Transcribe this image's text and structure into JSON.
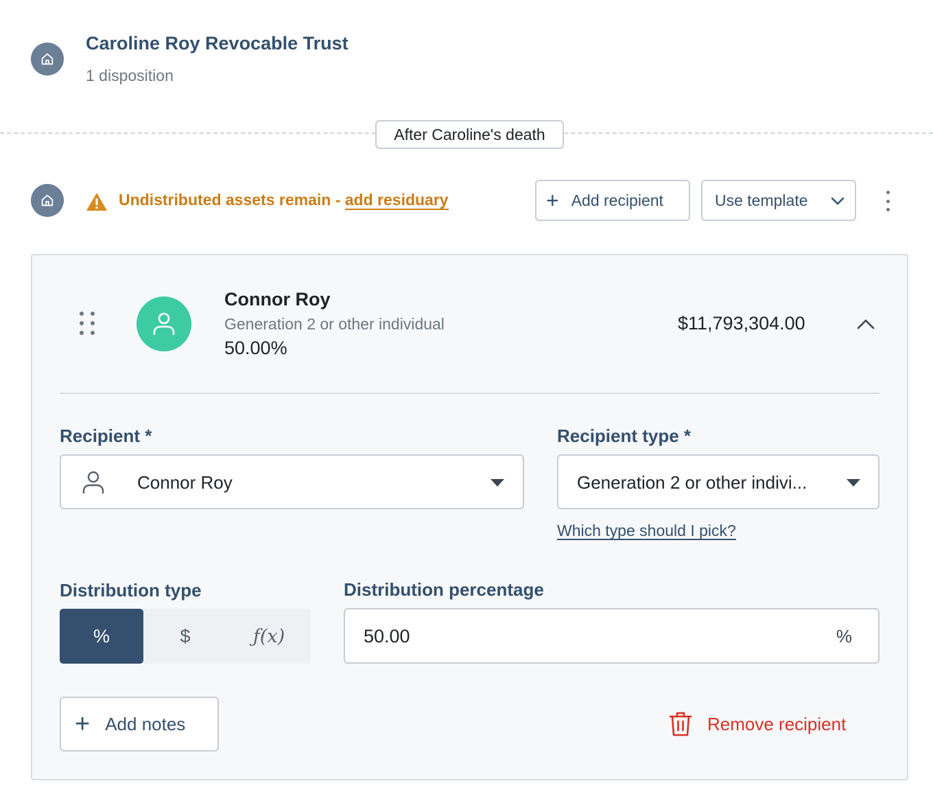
{
  "header": {
    "title": "Caroline Roy Revocable Trust",
    "subtitle": "1 disposition"
  },
  "timeline": {
    "label": "After Caroline's death"
  },
  "warning": {
    "text": "Undistributed assets remain - ",
    "link": "add residuary"
  },
  "toolbar": {
    "add_recipient": "Add recipient",
    "use_template": "Use template"
  },
  "recipient_card": {
    "name": "Connor Roy",
    "type": "Generation 2 or other individual",
    "percentage": "50.00%",
    "amount": "$11,793,304.00",
    "form": {
      "recipient_label": "Recipient *",
      "recipient_value": "Connor Roy",
      "recipient_type_label": "Recipient type *",
      "recipient_type_value": "Generation 2 or other indivi...",
      "help_link": "Which type should I pick?",
      "distribution_type_label": "Distribution type",
      "distribution_options": [
        "%",
        "$",
        "ƒ(x)"
      ],
      "distribution_selected": "%",
      "distribution_percentage_label": "Distribution percentage",
      "distribution_percentage_value": "50.00",
      "distribution_unit": "%",
      "add_notes": "Add notes",
      "remove_recipient": "Remove recipient"
    }
  },
  "colors": {
    "primary": "#34506e",
    "warning": "#c97d18",
    "avatar": "#3dcba4",
    "danger": "#d93025",
    "badge": "#6b7f96"
  }
}
